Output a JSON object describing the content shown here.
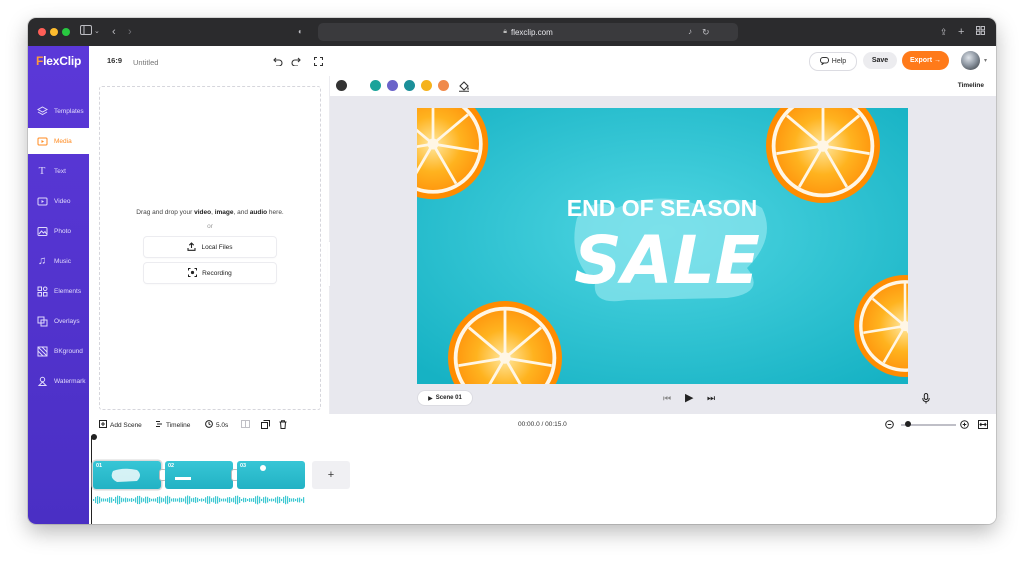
{
  "browser": {
    "url": "flexclip.com"
  },
  "app": {
    "logo": "FlexClip",
    "logo_first": "F",
    "logo_rest": "lexClip"
  },
  "sidebar": {
    "items": [
      {
        "label": "Templates",
        "icon": "layers-icon"
      },
      {
        "label": "Media",
        "icon": "media-icon",
        "active": true
      },
      {
        "label": "Text",
        "icon": "text-icon"
      },
      {
        "label": "Video",
        "icon": "video-icon"
      },
      {
        "label": "Photo",
        "icon": "photo-icon"
      },
      {
        "label": "Music",
        "icon": "music-icon"
      },
      {
        "label": "Elements",
        "icon": "elements-icon"
      },
      {
        "label": "Overlays",
        "icon": "overlays-icon"
      },
      {
        "label": "BKground",
        "icon": "background-icon"
      },
      {
        "label": "Watermark",
        "icon": "watermark-icon"
      }
    ]
  },
  "topbar": {
    "aspect_ratio": "16:9",
    "title_placeholder": "Untitled",
    "help_label": "Help",
    "save_label": "Save",
    "export_label": "Export →"
  },
  "media_panel": {
    "drop_prefix": "Drag and drop your",
    "drop_video": "video",
    "drop_sep1": ",",
    "drop_image": "image",
    "drop_sep2": ", and",
    "drop_audio": "audio",
    "drop_suffix": "here.",
    "or_text": "or",
    "local_files_label": "Local Files",
    "recording_label": "Recording"
  },
  "color_bar": {
    "swatches": [
      "#333333",
      "#1aa39a",
      "#6a63c9",
      "#1b8f99",
      "#f5b21c",
      "#f08a4b"
    ],
    "timeline_link": "Timeline"
  },
  "canvas": {
    "headline": "END OF SEASON",
    "sale": "SALE",
    "bg_color": "#1fbfd0"
  },
  "playback": {
    "scene_label": "Scene 01"
  },
  "timeline_toolbar": {
    "add_scene_label": "Add Scene",
    "timeline_label": "Timeline",
    "duration_label": "5.0s",
    "time_readout": "00:00.0 / 00:15.0",
    "zoom_level": 0.12
  },
  "timeline": {
    "clips": [
      {
        "number": "01"
      },
      {
        "number": "02"
      },
      {
        "number": "03"
      }
    ],
    "add_label": "+"
  }
}
